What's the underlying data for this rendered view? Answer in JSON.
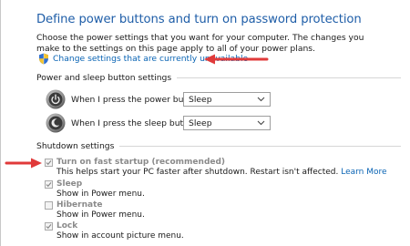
{
  "header": {
    "title": "Define power buttons and turn on password protection",
    "description": "Choose the power settings that you want for your computer. The changes you make to the settings on this page apply to all of your power plans.",
    "change_link": "Change settings that are currently unavailable"
  },
  "power_section": {
    "heading": "Power and sleep button settings",
    "rows": [
      {
        "label": "When I press the power button:",
        "value": "Sleep",
        "icon": "power-button-icon"
      },
      {
        "label": "When I press the sleep button:",
        "value": "Sleep",
        "icon": "sleep-button-icon"
      }
    ]
  },
  "shutdown_section": {
    "heading": "Shutdown settings",
    "options": [
      {
        "label": "Turn on fast startup (recommended)",
        "checked": true,
        "desc": "This helps start your PC faster after shutdown. Restart isn't affected.",
        "link": "Learn More"
      },
      {
        "label": "Sleep",
        "checked": true,
        "desc": "Show in Power menu."
      },
      {
        "label": "Hibernate",
        "checked": false,
        "desc": "Show in Power menu."
      },
      {
        "label": "Lock",
        "checked": true,
        "desc": "Show in account picture menu."
      }
    ]
  },
  "colors": {
    "title": "#1f5ea8",
    "link": "#0a64b4",
    "annotation_arrow": "#e03a3a",
    "disabled_text": "#8a8a8a"
  }
}
